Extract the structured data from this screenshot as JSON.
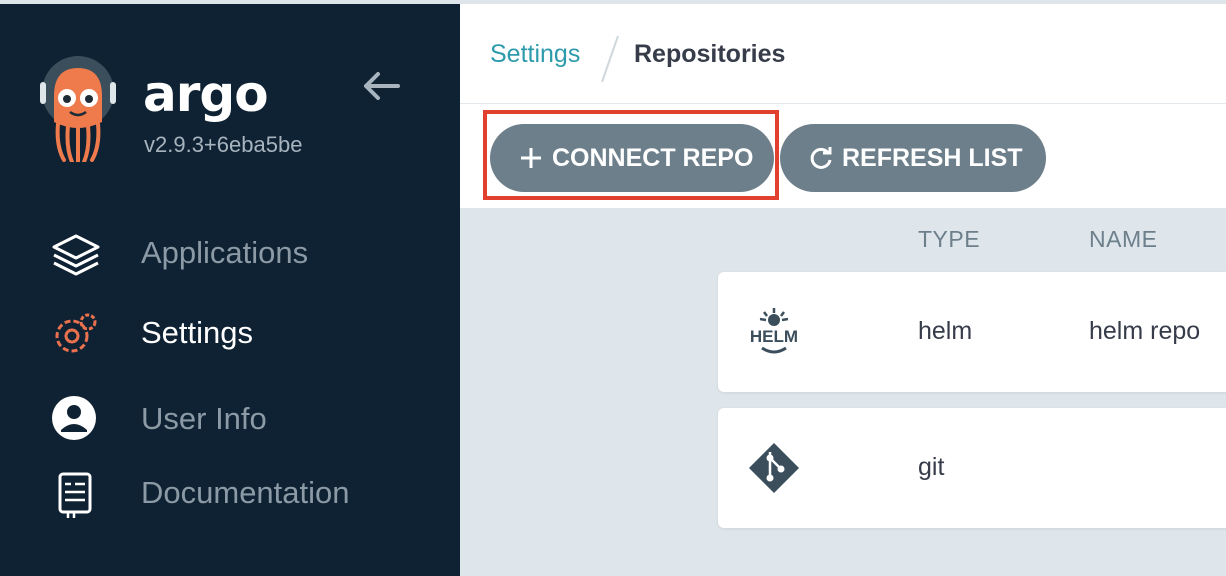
{
  "sidebar": {
    "brand": "argo",
    "version": "v2.9.3+6eba5be",
    "items": [
      {
        "label": "Applications",
        "icon": "layers-icon"
      },
      {
        "label": "Settings",
        "icon": "gear-icon",
        "active": true
      },
      {
        "label": "User Info",
        "icon": "user-icon"
      },
      {
        "label": "Documentation",
        "icon": "book-icon"
      }
    ]
  },
  "breadcrumb": {
    "parent": "Settings",
    "current": "Repositories"
  },
  "toolbar": {
    "connect_label": "CONNECT REPO",
    "refresh_label": "REFRESH LIST"
  },
  "table": {
    "headers": {
      "type": "TYPE",
      "name": "NAME"
    },
    "rows": [
      {
        "type": "helm",
        "name": "helm repo",
        "icon": "helm-icon",
        "icon_text": "HELM"
      },
      {
        "type": "git",
        "name": "",
        "icon": "git-icon"
      }
    ]
  },
  "colors": {
    "sidebar_bg": "#0f2233",
    "accent": "#2e9bad",
    "button": "#6d7f8b",
    "highlight": "#e0402d",
    "active_icon": "#e9714d"
  }
}
